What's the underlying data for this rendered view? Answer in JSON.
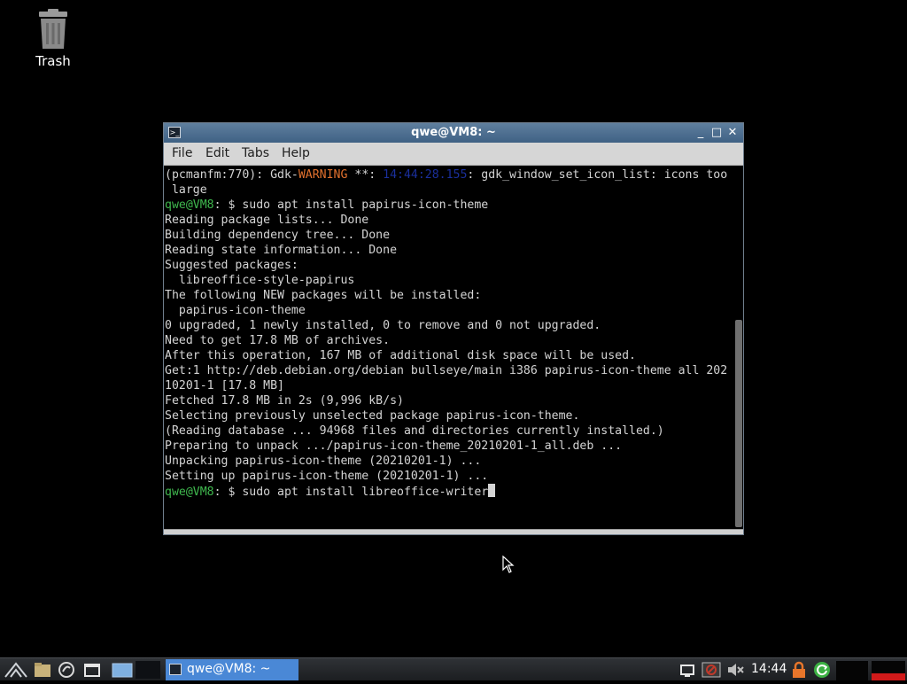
{
  "desktop": {
    "trash_label": "Trash"
  },
  "window": {
    "title": "qwe@VM8: ~",
    "menu": [
      "File",
      "Edit",
      "Tabs",
      "Help"
    ],
    "controls": {
      "minimize": "_",
      "maximize": "□",
      "close": "✕"
    }
  },
  "terminal": {
    "prompt": "qwe@VM8",
    "lines": [
      "(pcmanfm:770): Gdk-",
      "WARNING",
      " **: ",
      "14:44:28.155",
      ": gdk_window_set_icon_list: icons too",
      " large",
      ": $ sudo apt install papirus-icon-theme",
      "Reading package lists... Done",
      "Building dependency tree... Done",
      "Reading state information... Done",
      "Suggested packages:",
      "  libreoffice-style-papirus",
      "The following NEW packages will be installed:",
      "  papirus-icon-theme",
      "0 upgraded, 1 newly installed, 0 to remove and 0 not upgraded.",
      "Need to get 17.8 MB of archives.",
      "After this operation, 167 MB of additional disk space will be used.",
      "Get:1 http://deb.debian.org/debian bullseye/main i386 papirus-icon-theme all 202",
      "10201-1 [17.8 MB]",
      "Fetched 17.8 MB in 2s (9,996 kB/s)",
      "Selecting previously unselected package papirus-icon-theme.",
      "(Reading database ... 94968 files and directories currently installed.)",
      "Preparing to unpack .../papirus-icon-theme_20210201-1_all.deb ...",
      "Unpacking papirus-icon-theme (20210201-1) ...",
      "Setting up papirus-icon-theme (20210201-1) ...",
      ": $ sudo apt install libreoffice-writer"
    ]
  },
  "taskbar": {
    "task_label": "qwe@VM8: ~",
    "clock": "14:44"
  },
  "colors": {
    "prompt_green": "#3fb84e",
    "warning_orange": "#e0702d",
    "titlebar_blue": "#4f7295",
    "task_active": "#4a88d6"
  }
}
